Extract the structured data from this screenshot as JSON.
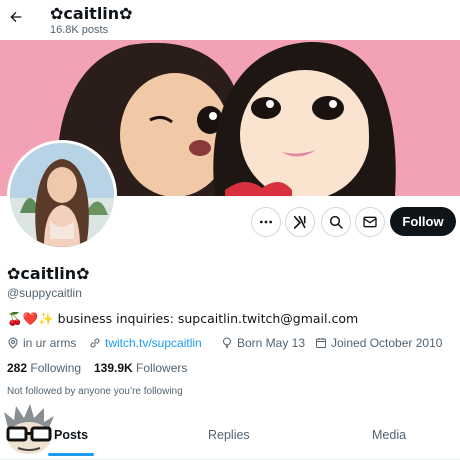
{
  "topbar": {
    "title": "✿caitlin✿",
    "posts_count": "16.8K posts"
  },
  "profile": {
    "display_name": "✿caitlin✿",
    "handle": "@suppycaitlin",
    "bio_emoji": "🍒❤️✨",
    "bio_text": " business inquiries: supcaitlin.twitch@gmail.com",
    "location": "in ur arms",
    "website": "twitch.tv/supcaitlin",
    "birthday": "Born May 13",
    "joined": "Joined October 2010",
    "following_count": "282",
    "following_label": "Following",
    "followers_count": "139.9K",
    "followers_label": "Followers",
    "not_followed_text": "Not followed by anyone you’re following"
  },
  "actions": {
    "follow_label": "Follow",
    "more_icon": "more-icon",
    "grok_icon": "grok-icon",
    "search_icon": "search-icon",
    "message_icon": "message-icon"
  },
  "tabs": [
    {
      "label": "Posts",
      "active": true
    },
    {
      "label": "Replies",
      "active": false
    },
    {
      "label": "Media",
      "active": false
    }
  ],
  "colors": {
    "accent": "#1d9bf0",
    "banner_bg": "#f3a2b4",
    "follow_bg": "#0f1419",
    "secondary_text": "#536471"
  }
}
